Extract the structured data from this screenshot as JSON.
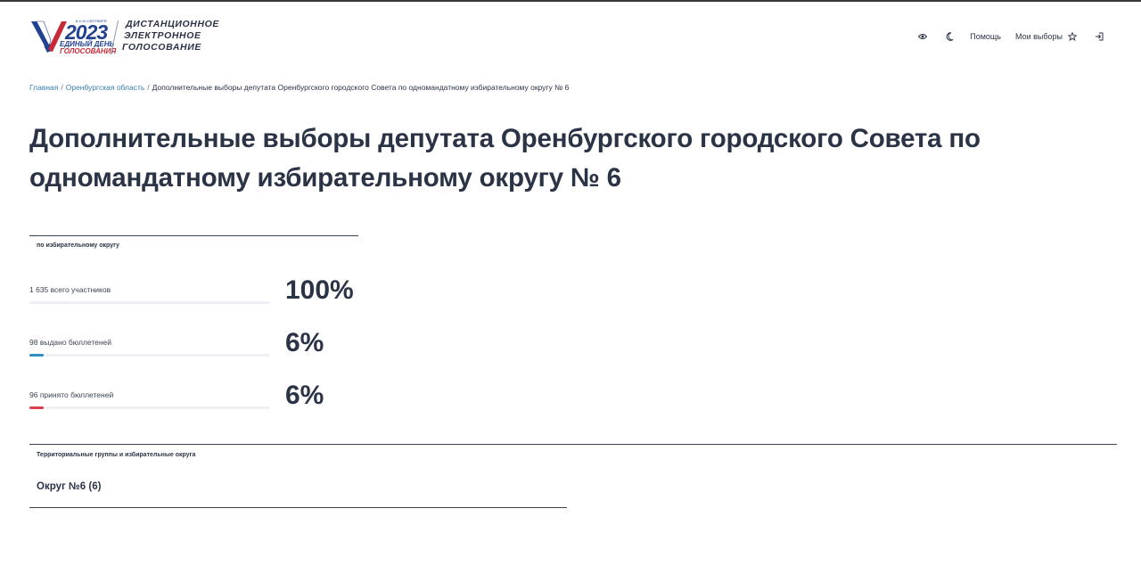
{
  "header": {
    "logo": {
      "year": "2023",
      "line1": "ЕДИНЫЙ ДЕНЬ",
      "line2": "ГОЛОСОВАНИЯ",
      "tiny": "8-9-10 СЕНТЯБРЯ",
      "title_lines": [
        "ДИСТАНЦИОННОЕ",
        "ЭЛЕКТРОННОЕ",
        "ГОЛОСОВАНИЕ"
      ]
    },
    "nav": {
      "help": "Помощь",
      "my_elections": "Мои выборы"
    }
  },
  "breadcrumb": {
    "home": "Главная",
    "region": "Оренбургская область",
    "current": "Дополнительные выборы депутата Оренбургского городского Совета по одномандатному избирательному округу № 6",
    "separator": "/"
  },
  "page_title": "Дополнительные выборы депутата Оренбургского городского Совета по одномандатному избирательному округу № 6",
  "stats": {
    "caption": "по избирательному округу",
    "rows": [
      {
        "label": "1 635 всего участников",
        "percent": "100%",
        "fill": 0,
        "color": "#2f8fc0"
      },
      {
        "label": "98 выдано бюллетеней",
        "percent": "6%",
        "fill": 0.06,
        "color": "#2f8fc0"
      },
      {
        "label": "96 принято бюллетеней",
        "percent": "6%",
        "fill": 0.06,
        "color": "#d9434f"
      }
    ]
  },
  "territorial": {
    "caption": "Территориальные группы и избирательные округа",
    "items": [
      {
        "label": "Округ №6 (6)"
      }
    ]
  },
  "colors": {
    "text": "#2b3446",
    "link": "#3a7fb0",
    "brand_blue": "#22418f",
    "brand_red": "#c62a3a"
  }
}
